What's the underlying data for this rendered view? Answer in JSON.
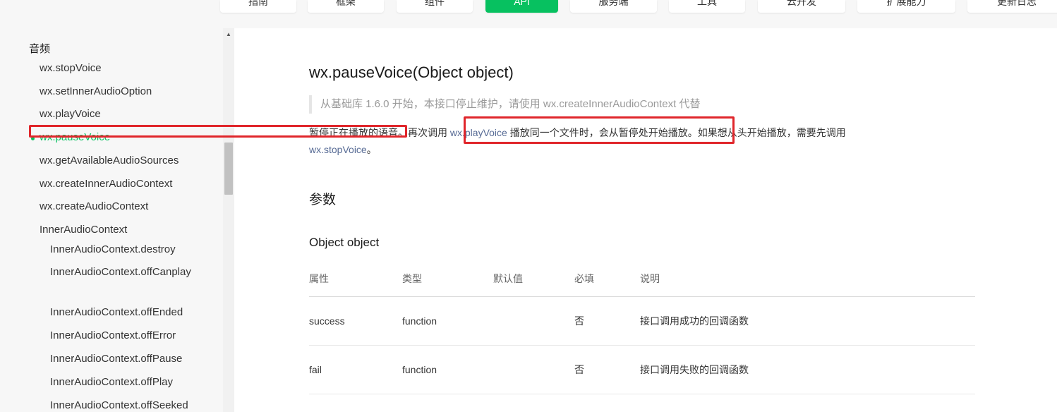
{
  "topnav": {
    "tabs": [
      {
        "label": "指南",
        "active": false
      },
      {
        "label": "框架",
        "active": false
      },
      {
        "label": "组件",
        "active": false
      },
      {
        "label": "API",
        "active": true
      },
      {
        "label": "服务端",
        "active": false
      },
      {
        "label": "工具",
        "active": false
      },
      {
        "label": "云开发",
        "active": false
      },
      {
        "label": "扩展能力",
        "active": false
      },
      {
        "label": "更新日志",
        "active": false
      }
    ]
  },
  "sidebar": {
    "group_title": "音频",
    "items": [
      {
        "label": "wx.stopVoice",
        "level": 1
      },
      {
        "label": "wx.setInnerAudioOption",
        "level": 1
      },
      {
        "label": "wx.playVoice",
        "level": 1
      },
      {
        "label": "wx.pauseVoice",
        "level": 1,
        "active": true
      },
      {
        "label": "wx.getAvailableAudioSources",
        "level": 1
      },
      {
        "label": "wx.createInnerAudioContext",
        "level": 1
      },
      {
        "label": "wx.createAudioContext",
        "level": 1
      },
      {
        "label": "InnerAudioContext",
        "level": 1
      },
      {
        "label": "InnerAudioContext.destroy",
        "level": 2
      },
      {
        "label": "InnerAudioContext.offCanplay",
        "level": 2
      },
      {
        "label": "InnerAudioContext.offEnded",
        "level": 2
      },
      {
        "label": "InnerAudioContext.offError",
        "level": 2
      },
      {
        "label": "InnerAudioContext.offPause",
        "level": 2
      },
      {
        "label": "InnerAudioContext.offPlay",
        "level": 2
      },
      {
        "label": "InnerAudioContext.offSeeked",
        "level": 2
      }
    ]
  },
  "main": {
    "title": "wx.pauseVoice(Object object)",
    "notice": {
      "prefix": "从基础库 1.6.0 开始，本接口停止维护，请使用 ",
      "link": "wx.createInnerAudioContext",
      "suffix": " 代替"
    },
    "description": {
      "part1": "暂停正在播放的语音。再次调用 ",
      "link1": "wx.playVoice",
      "part2": " 播放同一个文件时，会从暂停处开始播放。如果想从头开始播放，需要先调用 ",
      "link2": "wx.stopVoice",
      "part3": "。"
    },
    "section_title": "参数",
    "sub_title": "Object object",
    "table": {
      "headers": [
        "属性",
        "类型",
        "默认值",
        "必填",
        "说明"
      ],
      "rows": [
        [
          "success",
          "function",
          "",
          "否",
          "接口调用成功的回调函数"
        ],
        [
          "fail",
          "function",
          "",
          "否",
          "接口调用失败的回调函数"
        ]
      ]
    }
  },
  "colors": {
    "accent": "#07c160",
    "link": "#576b95",
    "annotation": "#e0262b"
  }
}
